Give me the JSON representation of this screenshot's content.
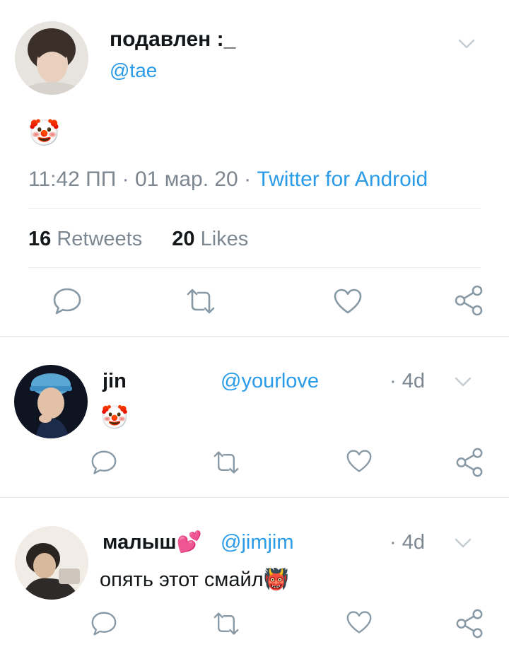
{
  "main_tweet": {
    "display_name": "подавлен :_",
    "handle": "@tae",
    "text_emoji": "🤡",
    "time": "11:42 ПП",
    "date": "01 мар. 20",
    "source": "Twitter for Android",
    "sep": "·",
    "retweets_count": "16",
    "retweets_label": "Retweets",
    "likes_count": "20",
    "likes_label": "Likes"
  },
  "replies": [
    {
      "display_name": "jin",
      "handle": "@yourlove",
      "age": "· 4d",
      "text": "🤡"
    },
    {
      "display_name": "малыш💕",
      "handle": "@jimjim",
      "age": "· 4d",
      "text": "опять этот смайл👹"
    }
  ],
  "icons": [
    "chevron-down-icon",
    "reply-icon",
    "retweet-icon",
    "like-icon",
    "share-icon"
  ],
  "colors": {
    "link_blue": "#2a9be8",
    "text": "#14171a",
    "muted": "#7c8791",
    "icon": "#8899a6",
    "divider": "#e6ecf0"
  }
}
